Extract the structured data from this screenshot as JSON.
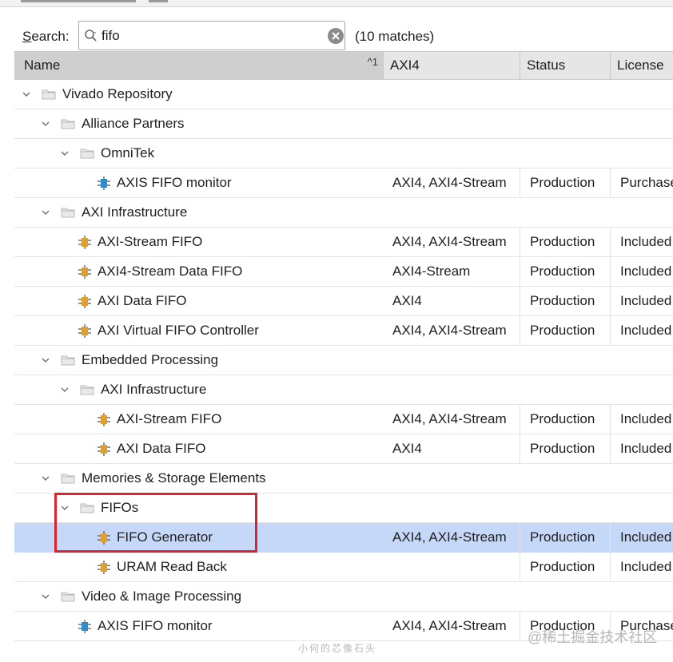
{
  "search": {
    "label_prefix": "S",
    "label_rest": "earch:",
    "value": "fifo",
    "match_count": "(10 matches)"
  },
  "columns": {
    "name": "Name",
    "sort_indicator": "^1",
    "axi": "AXI4",
    "status": "Status",
    "license": "License"
  },
  "tree": [
    {
      "kind": "folder",
      "level": 0,
      "name": "Vivado Repository"
    },
    {
      "kind": "folder",
      "level": 1,
      "name": "Alliance Partners"
    },
    {
      "kind": "folder",
      "level": 2,
      "name": "OmniTek"
    },
    {
      "kind": "ip",
      "level": 3,
      "icon": "blue",
      "name": "AXIS FIFO monitor",
      "axi": "AXI4, AXI4-Stream",
      "status": "Production",
      "license": "Purchase"
    },
    {
      "kind": "folder",
      "level": 1,
      "name": "AXI Infrastructure"
    },
    {
      "kind": "ip",
      "level": 2,
      "icon": "orange",
      "name": "AXI-Stream FIFO",
      "axi": "AXI4, AXI4-Stream",
      "status": "Production",
      "license": "Included"
    },
    {
      "kind": "ip",
      "level": 2,
      "icon": "orange",
      "name": "AXI4-Stream Data FIFO",
      "axi": "AXI4-Stream",
      "status": "Production",
      "license": "Included"
    },
    {
      "kind": "ip",
      "level": 2,
      "icon": "orange",
      "name": "AXI Data FIFO",
      "axi": "AXI4",
      "status": "Production",
      "license": "Included"
    },
    {
      "kind": "ip",
      "level": 2,
      "icon": "orange",
      "name": "AXI Virtual FIFO Controller",
      "axi": "AXI4, AXI4-Stream",
      "status": "Production",
      "license": "Included"
    },
    {
      "kind": "folder",
      "level": 1,
      "name": "Embedded Processing"
    },
    {
      "kind": "folder",
      "level": 2,
      "name": "AXI Infrastructure"
    },
    {
      "kind": "ip",
      "level": 3,
      "icon": "orange",
      "name": "AXI-Stream FIFO",
      "axi": "AXI4, AXI4-Stream",
      "status": "Production",
      "license": "Included"
    },
    {
      "kind": "ip",
      "level": 3,
      "icon": "orange",
      "name": "AXI Data FIFO",
      "axi": "AXI4",
      "status": "Production",
      "license": "Included"
    },
    {
      "kind": "folder",
      "level": 1,
      "name": "Memories & Storage Elements"
    },
    {
      "kind": "folder",
      "level": 2,
      "name": "FIFOs"
    },
    {
      "kind": "ip",
      "level": 3,
      "icon": "orange",
      "name": "FIFO Generator",
      "axi": "AXI4, AXI4-Stream",
      "status": "Production",
      "license": "Included",
      "selected": true
    },
    {
      "kind": "ip",
      "level": 3,
      "icon": "orange",
      "name": "URAM Read Back",
      "axi": "",
      "status": "Production",
      "license": "Included"
    },
    {
      "kind": "folder",
      "level": 1,
      "name": "Video & Image Processing"
    },
    {
      "kind": "ip",
      "level": 2,
      "icon": "blue",
      "name": "AXIS FIFO monitor",
      "axi": "AXI4, AXI4-Stream",
      "status": "Production",
      "license": "Purchase"
    }
  ],
  "watermark": "@稀土掘金技术社区",
  "watermark_small": "小何的芯像石头",
  "colors": {
    "selection": "#c5d8f7",
    "highlight_box": "#e0202a",
    "ip_orange": "#e0a030",
    "ip_blue": "#2a8fd0",
    "folder": "#b9b9b9"
  },
  "icons": {
    "search": "magnifier-icon",
    "clear": "clear-circle-icon",
    "expand": "chevron-down-icon",
    "folder": "folder-icon",
    "ip": "ip-core-icon"
  }
}
